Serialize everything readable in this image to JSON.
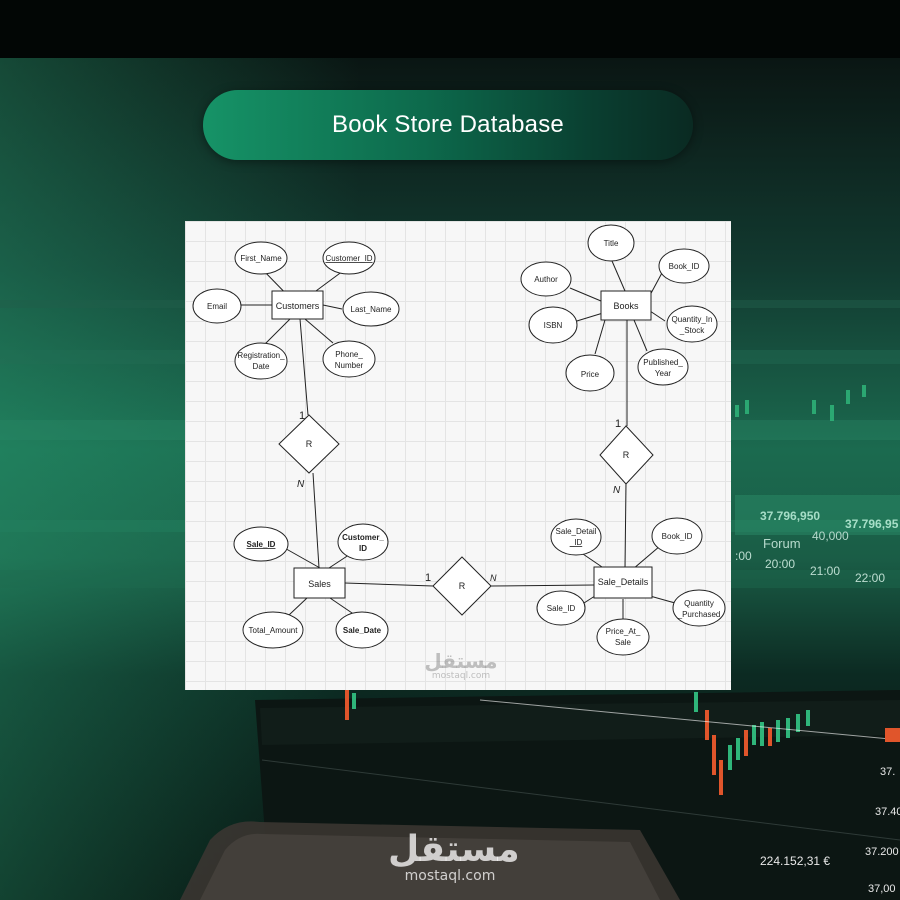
{
  "title": "Book Store Database",
  "colors": {
    "accent": "#169367",
    "card_background": "#f7f7f7",
    "stroke": "#222222"
  },
  "entities": {
    "customers": "Customers",
    "books": "Books",
    "sales": "Sales",
    "sale_details": "Sale_Details"
  },
  "attributes": {
    "customers": {
      "first_name": "First_Name",
      "customer_id": "Customer_ID",
      "email": "Email",
      "last_name": "Last_Name",
      "registration_date": [
        "Registration_",
        "Date"
      ],
      "phone_number": [
        "Phone_",
        "Number"
      ]
    },
    "books": {
      "title": "Title",
      "author": "Author",
      "book_id": "Book_ID",
      "isbn": "ISBN",
      "quantity_in_stock": [
        "Quantity_In",
        "_Stock"
      ],
      "price": "Price",
      "published_year": [
        "Published_",
        "Year"
      ]
    },
    "sales": {
      "sale_id": "Sale_ID",
      "customer_id": [
        "Customer_",
        "ID"
      ],
      "total_amount": "Total_Amount",
      "sale_date": "Sale_Date"
    },
    "sale_details": {
      "sale_detail_id": [
        "Sale_Detail",
        "_ID"
      ],
      "book_id": "Book_ID",
      "sale_id": "Sale_ID",
      "price_at_sale": [
        "Price_At_",
        "Sale"
      ],
      "quantity_purchased": [
        "Quantity",
        "_Purchased"
      ]
    }
  },
  "relationships": {
    "r1": {
      "label": "R",
      "card_top": "1",
      "card_bottom": "N"
    },
    "r2": {
      "label": "R",
      "card_top": "1",
      "card_bottom": "N"
    },
    "r3": {
      "label": "R",
      "card_left": "1",
      "card_right": "N"
    }
  },
  "watermark": {
    "arabic": "مستقل",
    "domain": "mostaql.com"
  }
}
